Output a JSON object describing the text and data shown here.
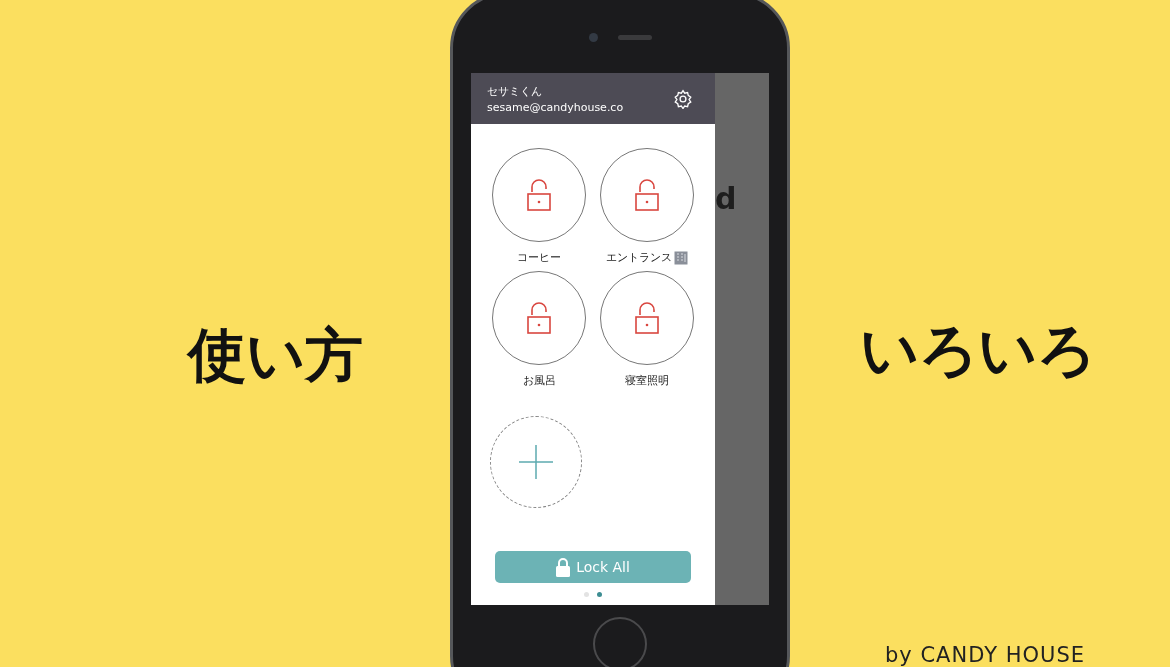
{
  "slide": {
    "left_caption": "使い方",
    "right_caption": "いろいろ",
    "credit": "by CANDY HOUSE"
  },
  "app": {
    "user": {
      "name": "セサミくん",
      "email": "sesame@candyhouse.co"
    },
    "background_text": "d",
    "locks": [
      {
        "label": "コーヒー",
        "locked": false,
        "kind": "plain"
      },
      {
        "label": "エントランス",
        "locked": false,
        "kind": "tagged"
      },
      {
        "label": "お風呂",
        "locked": false,
        "kind": "plain"
      },
      {
        "label": "寝室照明",
        "locked": false,
        "kind": "plain"
      }
    ],
    "lock_all_button": "Lock All",
    "pages": [
      {
        "selected": false
      },
      {
        "selected": true
      }
    ]
  }
}
